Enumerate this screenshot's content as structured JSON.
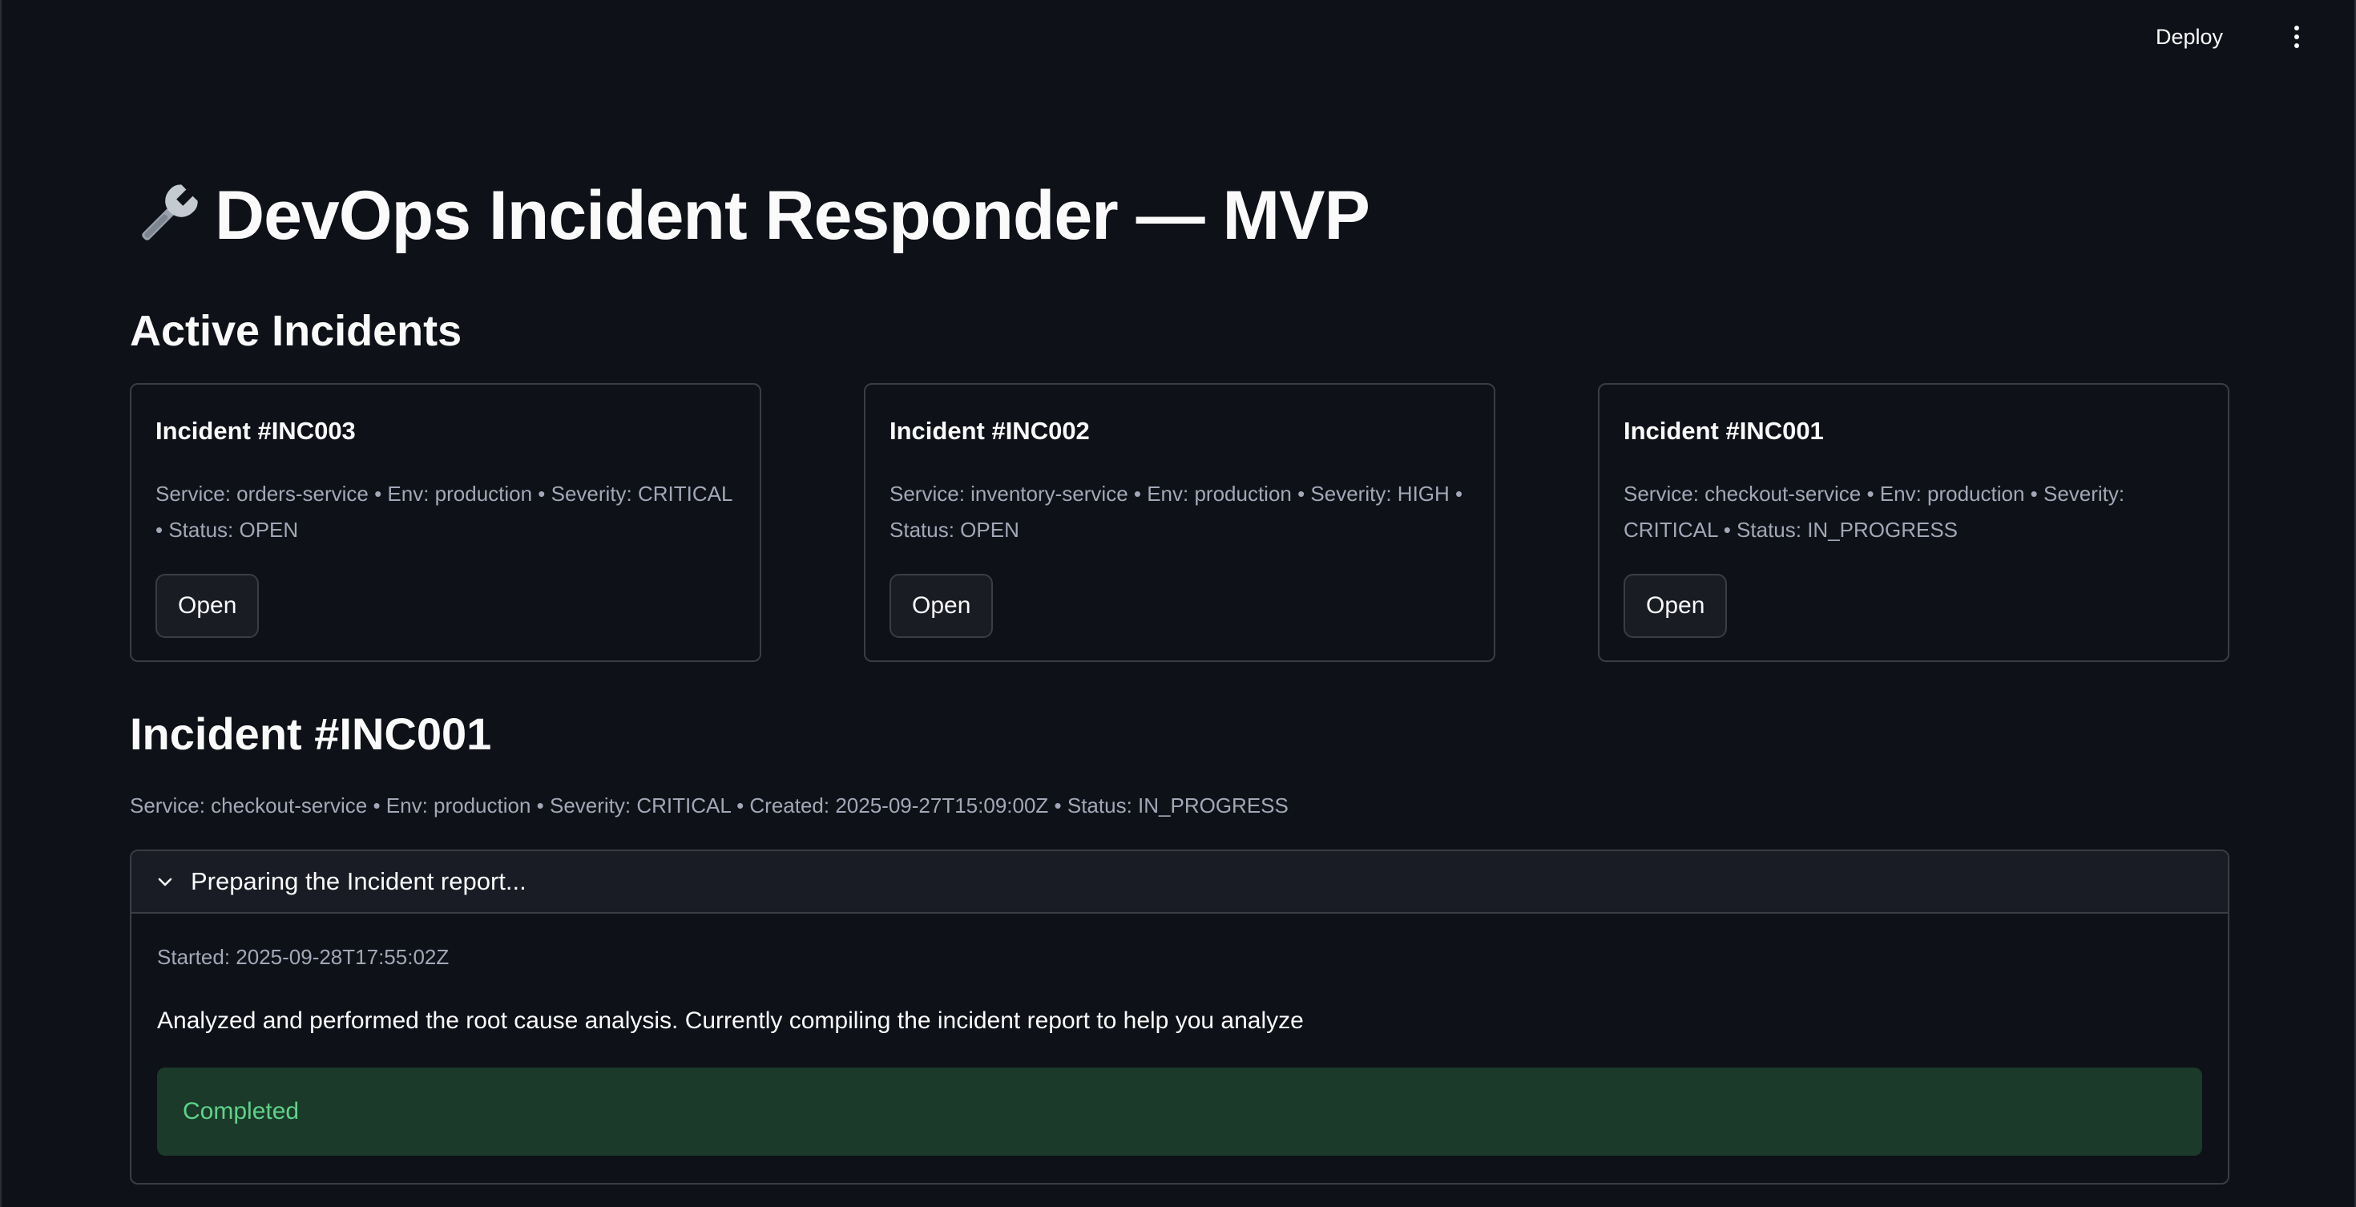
{
  "header": {
    "deploy_label": "Deploy",
    "menu_icon": "more-vertical-icon"
  },
  "page": {
    "title": "DevOps Incident Responder — MVP",
    "title_icon": "wrench-icon"
  },
  "active_incidents": {
    "heading": "Active Incidents",
    "cards": [
      {
        "title": "Incident #INC003",
        "meta": "Service: orders-service • Env: production • Severity: CRITICAL • Status: OPEN",
        "button_label": "Open"
      },
      {
        "title": "Incident #INC002",
        "meta": "Service: inventory-service • Env: production • Severity: HIGH • Status: OPEN",
        "button_label": "Open"
      },
      {
        "title": "Incident #INC001",
        "meta": "Service: checkout-service • Env: production • Severity: CRITICAL • Status: IN_PROGRESS",
        "button_label": "Open"
      }
    ]
  },
  "incident_detail": {
    "title": "Incident #INC001",
    "meta": "Service: checkout-service • Env: production • Severity: CRITICAL • Created: 2025-09-27T15:09:00Z • Status: IN_PROGRESS",
    "status_panel": {
      "label": "Preparing the Incident report...",
      "started": "Started: 2025-09-28T17:55:02Z",
      "description": "Analyzed and performed the root cause analysis. Currently compiling the incident report to help you analyze",
      "result": "Completed"
    }
  },
  "colors": {
    "background": "#0e1117",
    "card_border": "#3a3d45",
    "success_bg": "#1b3a2a",
    "success_text": "#5fd38a",
    "muted_text": "#a3a8b8"
  }
}
